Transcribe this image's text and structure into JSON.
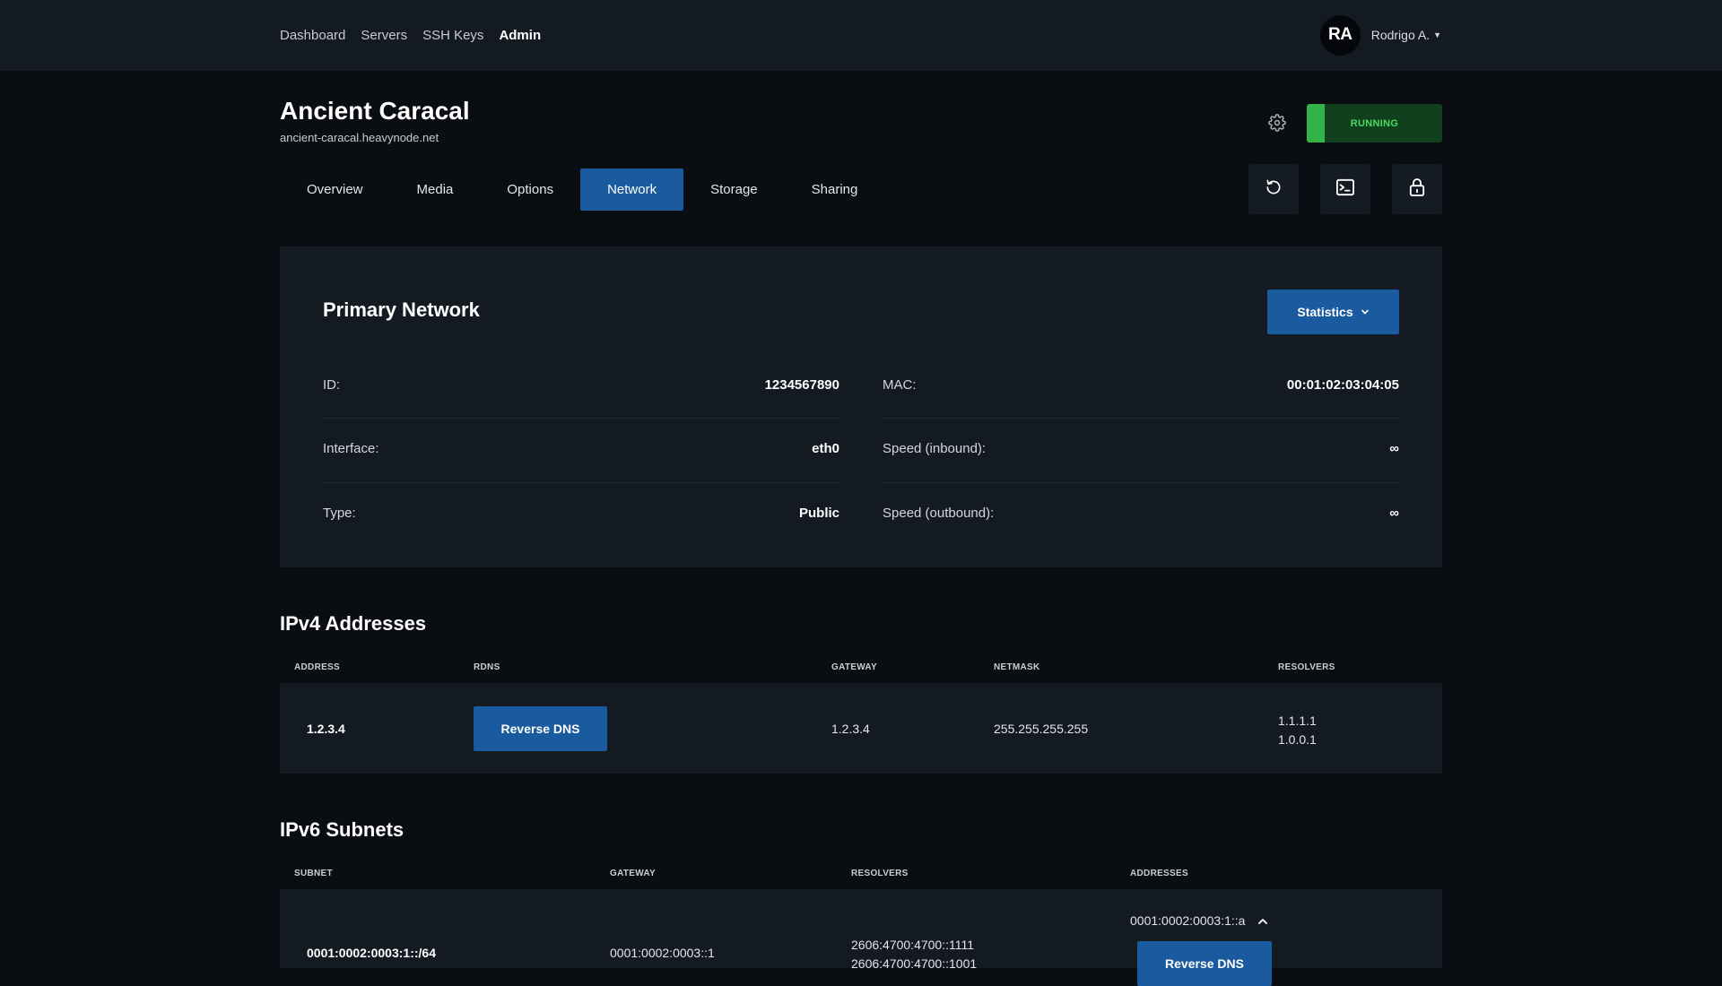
{
  "nav": {
    "items": [
      {
        "label": "Dashboard"
      },
      {
        "label": "Servers"
      },
      {
        "label": "SSH Keys"
      },
      {
        "label": "Admin"
      }
    ],
    "active": "Admin"
  },
  "user": {
    "initials": "RA",
    "name": "Rodrigo A."
  },
  "server": {
    "name": "Ancient Caracal",
    "hostname": "ancient-caracal.heavynode.net",
    "status": "RUNNING"
  },
  "tabs": [
    {
      "label": "Overview"
    },
    {
      "label": "Media"
    },
    {
      "label": "Options"
    },
    {
      "label": "Network",
      "active": true
    },
    {
      "label": "Storage"
    },
    {
      "label": "Sharing"
    }
  ],
  "actions": [
    {
      "icon": "restart-icon"
    },
    {
      "icon": "console-icon"
    },
    {
      "icon": "lock-icon"
    }
  ],
  "primary_network": {
    "title": "Primary Network",
    "statistics_label": "Statistics",
    "left": [
      {
        "key": "ID:",
        "value": "1234567890"
      },
      {
        "key": "Interface:",
        "value": "eth0"
      },
      {
        "key": "Type:",
        "value": "Public"
      }
    ],
    "right": [
      {
        "key": "MAC:",
        "value": "00:01:02:03:04:05"
      },
      {
        "key": "Speed (inbound):",
        "value": "∞"
      },
      {
        "key": "Speed (outbound):",
        "value": "∞"
      }
    ]
  },
  "ipv4": {
    "title": "IPv4 Addresses",
    "headers": [
      "ADDRESS",
      "RDNS",
      "GATEWAY",
      "NETMASK",
      "RESOLVERS"
    ],
    "rows": [
      {
        "address": "1.2.3.4",
        "rdns_label": "Reverse DNS",
        "gateway": "1.2.3.4",
        "netmask": "255.255.255.255",
        "resolvers": [
          "1.1.1.1",
          "1.0.0.1"
        ]
      }
    ]
  },
  "ipv6": {
    "title": "IPv6 Subnets",
    "headers": [
      "SUBNET",
      "GATEWAY",
      "RESOLVERS",
      "ADDRESSES"
    ],
    "rows": [
      {
        "subnet": "0001:0002:0003:1::/64",
        "gateway": "0001:0002:0003::1",
        "resolvers": [
          "2606:4700:4700::1111",
          "2606:4700:4700::1001"
        ],
        "address": "0001:0002:0003:1::a",
        "rdns_label": "Reverse DNS"
      }
    ]
  },
  "colors": {
    "accent": "#1a5a9e",
    "running_bg": "#11401c",
    "running_text": "#4cd964",
    "panel": "#141a22",
    "background": "#0a0d12"
  }
}
